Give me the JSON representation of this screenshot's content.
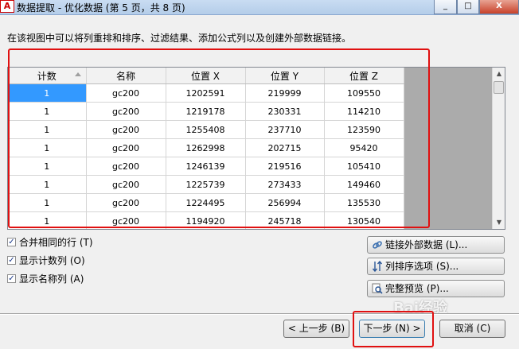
{
  "window": {
    "title": "数据提取 - 优化数据 (第 5 页，共 8 页)",
    "app_icon": "A",
    "buttons": {
      "minimize": "_",
      "maximize": "□",
      "close": "X"
    }
  },
  "instructions": "在该视图中可以将列重排和排序、过滤结果、添加公式列以及创建外部数据链接。",
  "grid": {
    "columns": [
      "计数",
      "名称",
      "位置 X",
      "位置 Y",
      "位置 Z"
    ],
    "sorted_column": "计数",
    "rows": [
      [
        "1",
        "gc200",
        "1202591",
        "219999",
        "109550"
      ],
      [
        "1",
        "gc200",
        "1219178",
        "230331",
        "114210"
      ],
      [
        "1",
        "gc200",
        "1255408",
        "237710",
        "123590"
      ],
      [
        "1",
        "gc200",
        "1262998",
        "202715",
        "95420"
      ],
      [
        "1",
        "gc200",
        "1246139",
        "219516",
        "105410"
      ],
      [
        "1",
        "gc200",
        "1225739",
        "273433",
        "149460"
      ],
      [
        "1",
        "gc200",
        "1224495",
        "256994",
        "135530"
      ],
      [
        "1",
        "gc200",
        "1194920",
        "245718",
        "130540"
      ]
    ]
  },
  "options": {
    "merge_rows": "合并相同的行 (T)",
    "show_count": "显示计数列 (O)",
    "show_name": "显示名称列 (A)"
  },
  "side_buttons": {
    "link_external": "链接外部数据 (L)...",
    "sort_options": "列排序选项 (S)...",
    "full_preview": "完整预览 (P)..."
  },
  "footer": {
    "back": "< 上一步 (B)",
    "next": "下一步 (N) >",
    "cancel": "取消 (C)"
  },
  "watermark": "Bai经验",
  "colors": {
    "highlight_red": "#e01010",
    "selection_blue": "#3399ff"
  }
}
